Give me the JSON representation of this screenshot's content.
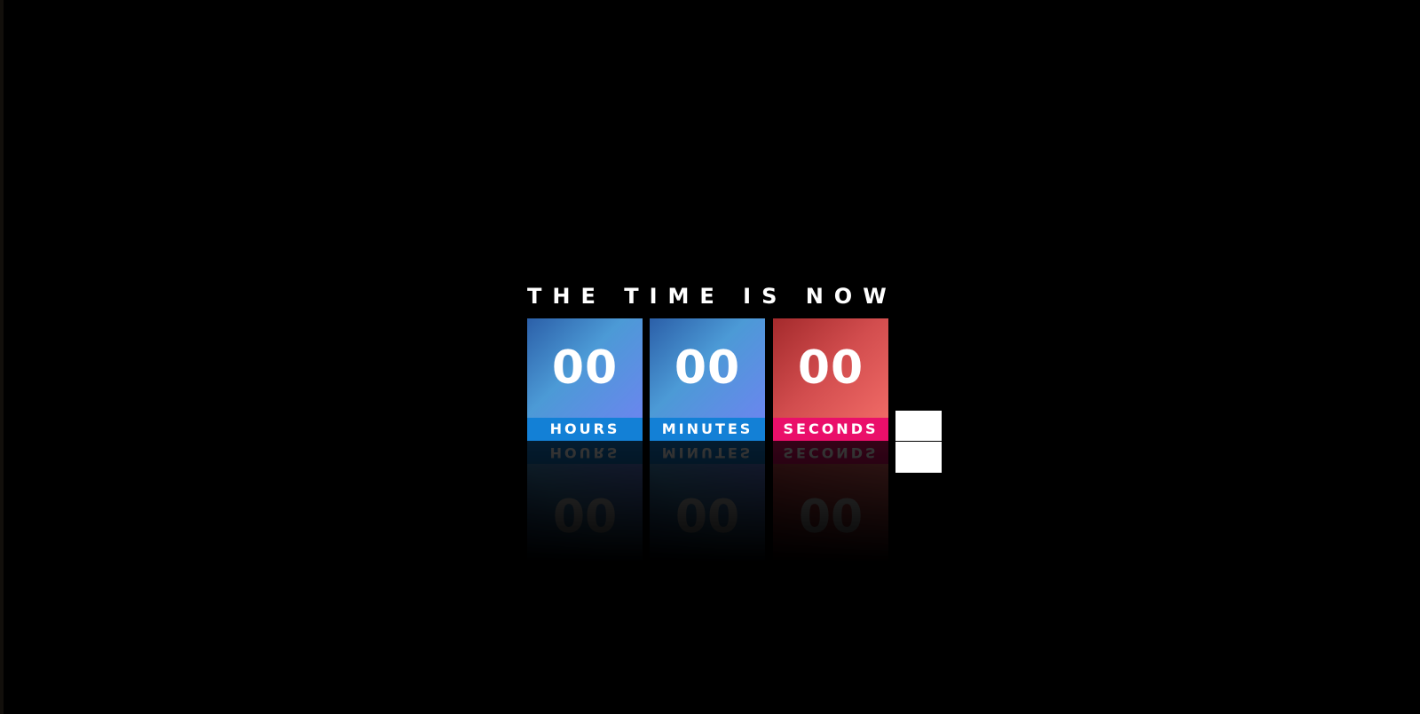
{
  "heading": "THE TIME IS NOW",
  "units": [
    {
      "value": "00",
      "label": "HOURS"
    },
    {
      "value": "00",
      "label": "MINUTES"
    },
    {
      "value": "00",
      "label": "SECONDS"
    }
  ],
  "colors": {
    "background": "#000000",
    "hours_label_bar": "#1380d6",
    "minutes_label_bar": "#1380d6",
    "seconds_label_bar": "#ea0f6a",
    "blue_tile": "#4c9ad6",
    "red_tile": "#d24d4e"
  }
}
